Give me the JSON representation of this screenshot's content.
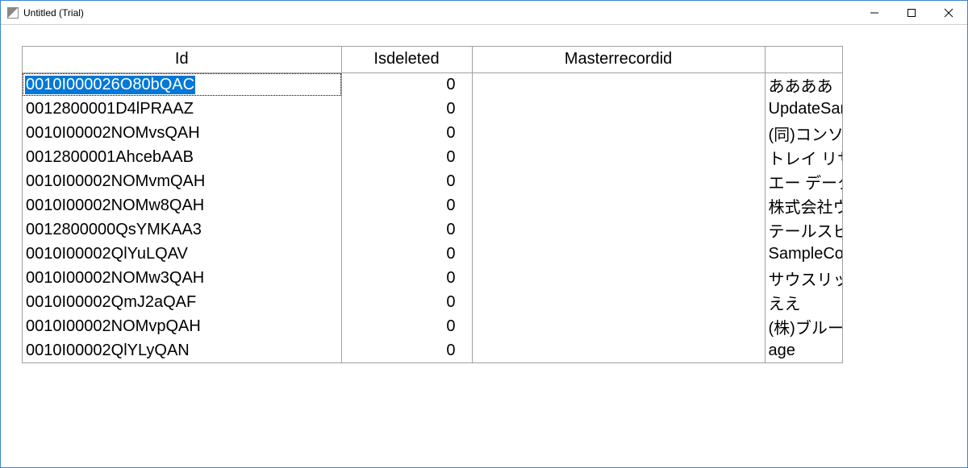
{
  "window": {
    "title": "Untitled (Trial)"
  },
  "grid": {
    "headers": {
      "id": "Id",
      "isdeleted": "Isdeleted",
      "masterrecordid": "Masterrecordid",
      "extra": ""
    },
    "rows": [
      {
        "id": "0010I000026O80bQAC",
        "isdeleted": "0",
        "master": "",
        "extra": "ああああ"
      },
      {
        "id": "0012800001D4lPRAAZ",
        "isdeleted": "0",
        "master": "",
        "extra": "UpdateSam"
      },
      {
        "id": "0010I00002NOMvsQAH",
        "isdeleted": "0",
        "master": "",
        "extra": "(同)コンソリデ"
      },
      {
        "id": "0012800001AhcebAAB",
        "isdeleted": "0",
        "master": "",
        "extra": "トレイ リサーチ"
      },
      {
        "id": "0010I00002NOMvmQAH",
        "isdeleted": "0",
        "master": "",
        "extra": "エー データム"
      },
      {
        "id": "0010I00002NOMw8QAH",
        "isdeleted": "0",
        "master": "",
        "extra": "株式会社ウィ"
      },
      {
        "id": "0012800000QsYMKAA3",
        "isdeleted": "0",
        "master": "",
        "extra": "テールスピン"
      },
      {
        "id": "0010I00002QlYuLQAV",
        "isdeleted": "0",
        "master": "",
        "extra": "SampleCom"
      },
      {
        "id": "0010I00002NOMw3QAH",
        "isdeleted": "0",
        "master": "",
        "extra": "サウスリッジ ビ"
      },
      {
        "id": "0010I00002QmJ2aQAF",
        "isdeleted": "0",
        "master": "",
        "extra": "ええ"
      },
      {
        "id": "0010I00002NOMvpQAH",
        "isdeleted": "0",
        "master": "",
        "extra": "(株)ブルー ヤ"
      },
      {
        "id": "0010I00002QlYLyQAN",
        "isdeleted": "0",
        "master": "",
        "extra": "age"
      }
    ]
  }
}
